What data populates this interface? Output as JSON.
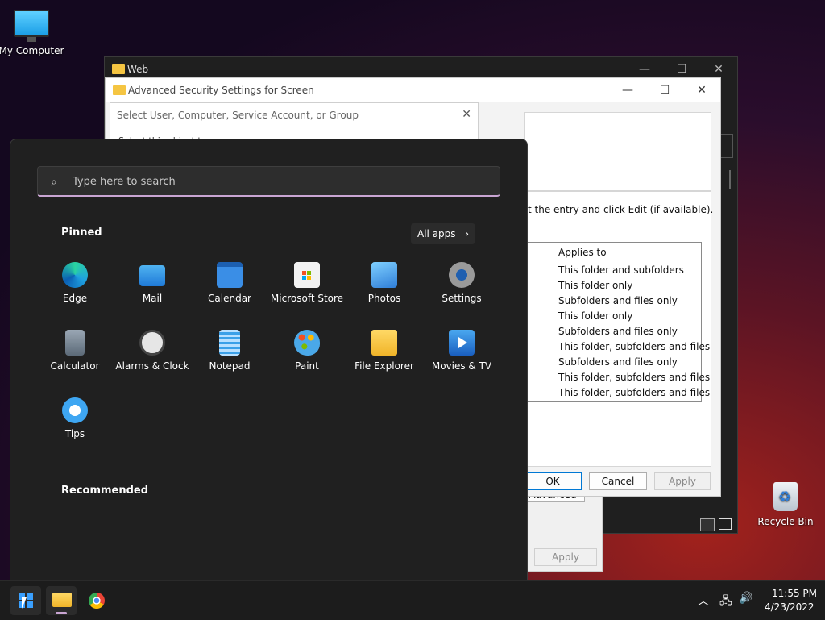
{
  "desktop": {
    "icons": [
      {
        "label": "My Computer"
      },
      {
        "label": "Recycle Bin"
      }
    ]
  },
  "web_window": {
    "title": "Web"
  },
  "security_window": {
    "title": "Advanced Security Settings for Screen",
    "instruction": "t the entry and click Edit (if available).",
    "table_header": "Applies to",
    "applies_to": [
      "This folder and subfolders",
      "This folder only",
      "Subfolders and files only",
      "This folder only",
      "Subfolders and files only",
      "This folder, subfolders and files",
      "Subfolders and files only",
      "This folder, subfolders and files",
      "This folder, subfolders and files"
    ],
    "ok_label": "OK",
    "cancel_label": "Cancel",
    "apply_label": "Apply",
    "advanced_label": "Advanced",
    "apply2_label": "Apply"
  },
  "select_dialog": {
    "title": "Select User, Computer, Service Account, or Group",
    "partial_text": "Select this object type"
  },
  "start_menu": {
    "search_placeholder": "Type here to search",
    "pinned_label": "Pinned",
    "all_apps_label": "All apps",
    "recommended_label": "Recommended",
    "apps": [
      {
        "label": "Edge",
        "icon": "edge-icon",
        "color": "#1fa0e0"
      },
      {
        "label": "Mail",
        "icon": "mail-icon",
        "color": "#2f8ee0"
      },
      {
        "label": "Calendar",
        "icon": "calendar-icon",
        "color": "#3a8ee6"
      },
      {
        "label": "Microsoft Store",
        "icon": "store-icon",
        "color": "#f0f0f0"
      },
      {
        "label": "Photos",
        "icon": "photos-icon",
        "color": "#3fa0f0"
      },
      {
        "label": "Settings",
        "icon": "gear-icon",
        "color": "#8a8a8a"
      },
      {
        "label": "Calculator",
        "icon": "calculator-icon",
        "color": "#6c7a89"
      },
      {
        "label": "Alarms & Clock",
        "icon": "clock-icon",
        "color": "#dcdcdc"
      },
      {
        "label": "Notepad",
        "icon": "notepad-icon",
        "color": "#3aa0e8"
      },
      {
        "label": "Paint",
        "icon": "paint-icon",
        "color": "#4aa8e8"
      },
      {
        "label": "File Explorer",
        "icon": "folder-icon",
        "color": "#f5c542"
      },
      {
        "label": "Movies & TV",
        "icon": "movies-icon",
        "color": "#2a7fe0"
      },
      {
        "label": "Tips",
        "icon": "lightbulb-icon",
        "color": "#3ea6f2"
      }
    ]
  },
  "taskbar": {
    "time": "11:55 PM",
    "date": "4/23/2022"
  }
}
